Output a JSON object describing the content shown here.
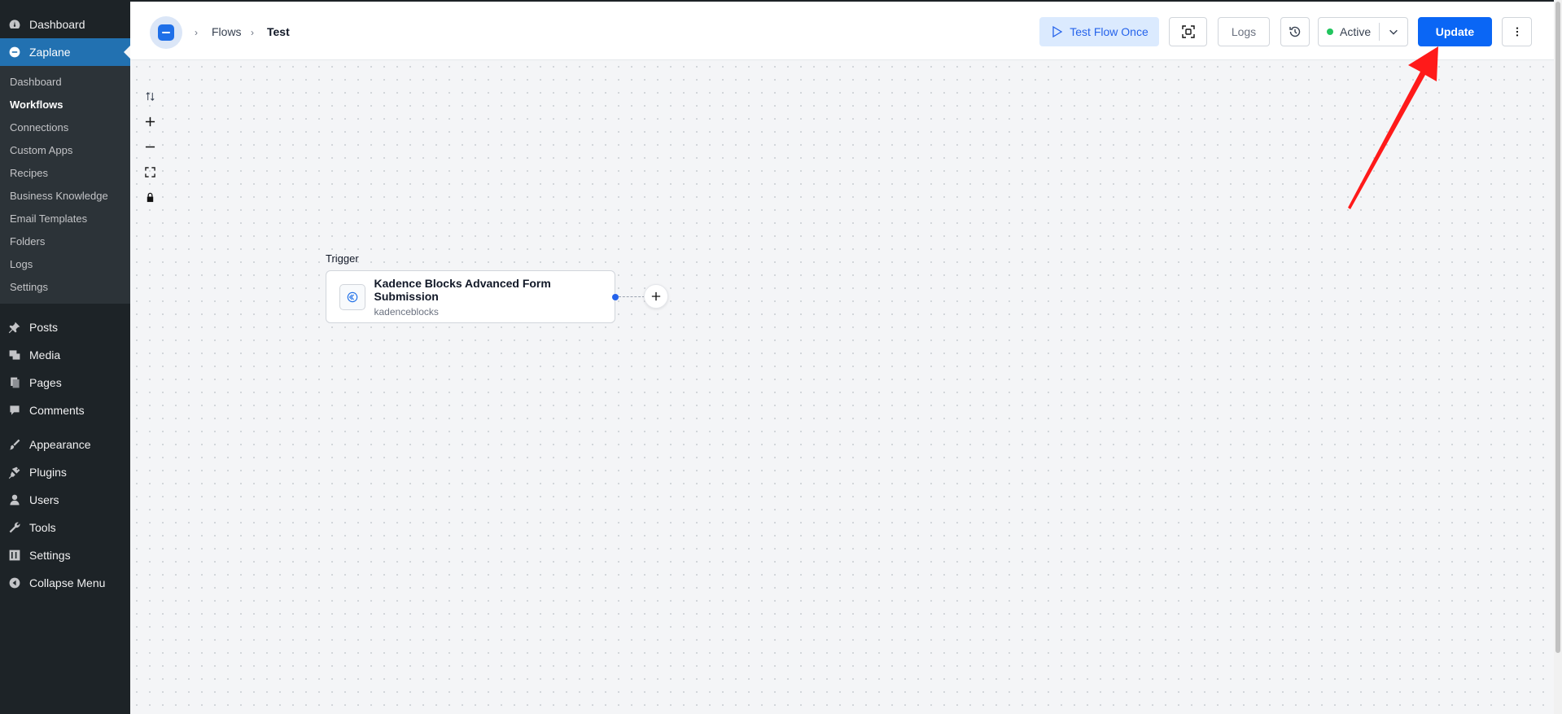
{
  "sidebar": {
    "top_items": [
      {
        "label": "Dashboard",
        "icon": "dashboard-icon"
      },
      {
        "label": "Zaplane",
        "icon": "zaplane-icon",
        "active": true
      }
    ],
    "submenu": [
      "Dashboard",
      "Workflows",
      "Connections",
      "Custom Apps",
      "Recipes",
      "Business Knowledge",
      "Email Templates",
      "Folders",
      "Logs",
      "Settings"
    ],
    "submenu_current": "Workflows",
    "main_items": [
      {
        "label": "Posts",
        "icon": "pin-icon"
      },
      {
        "label": "Media",
        "icon": "media-icon"
      },
      {
        "label": "Pages",
        "icon": "pages-icon"
      },
      {
        "label": "Comments",
        "icon": "comment-icon"
      },
      {
        "label": "Appearance",
        "icon": "brush-icon"
      },
      {
        "label": "Plugins",
        "icon": "plugin-icon"
      },
      {
        "label": "Users",
        "icon": "user-icon"
      },
      {
        "label": "Tools",
        "icon": "wrench-icon"
      },
      {
        "label": "Settings",
        "icon": "settings-icon"
      },
      {
        "label": "Collapse Menu",
        "icon": "collapse-icon"
      }
    ]
  },
  "header": {
    "breadcrumbs": [
      "Flows",
      "Test"
    ],
    "test_button": "Test Flow Once",
    "logs_button": "Logs",
    "status": "Active",
    "update_button": "Update"
  },
  "canvas": {
    "trigger_label": "Trigger",
    "node": {
      "title": "Kadence Blocks Advanced Form Submission",
      "subtitle": "kadenceblocks"
    }
  },
  "colors": {
    "accent": "#0a66f5",
    "wp_active": "#2271b1",
    "sidebar_bg": "#1d2327",
    "status_green": "#22c55e",
    "annotation_red": "#ff1a1a"
  }
}
